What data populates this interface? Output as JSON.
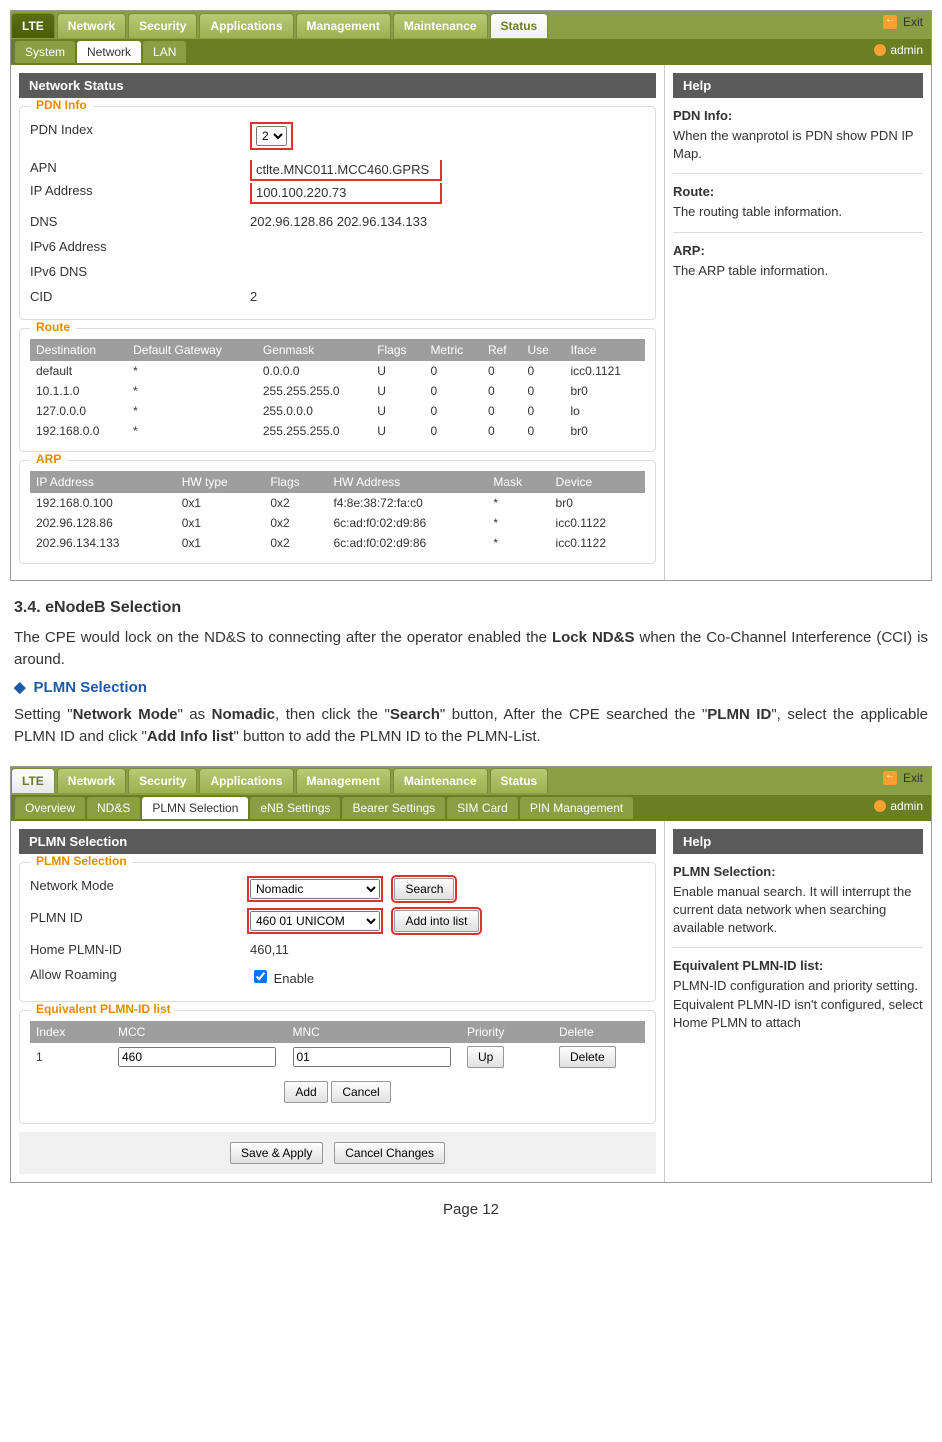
{
  "ui1": {
    "topTabs": [
      "LTE",
      "Network",
      "Security",
      "Applications",
      "Management",
      "Maintenance",
      "Status"
    ],
    "topActive": "Status",
    "exit": "Exit",
    "subTabs": [
      "System",
      "Network",
      "LAN"
    ],
    "subActive": "Network",
    "user": "admin",
    "mainTitle": "Network Status",
    "pdn": {
      "legend": "PDN Info",
      "rows": [
        {
          "label": "PDN Index",
          "value": "2",
          "select": true
        },
        {
          "label": "APN",
          "value": "ctlte.MNC011.MCC460.GPRS"
        },
        {
          "label": "IP Address",
          "value": "100.100.220.73"
        },
        {
          "label": "DNS",
          "value": "202.96.128.86    202.96.134.133"
        },
        {
          "label": "IPv6 Address",
          "value": ""
        },
        {
          "label": "IPv6 DNS",
          "value": ""
        },
        {
          "label": "CID",
          "value": "2"
        }
      ]
    },
    "route": {
      "legend": "Route",
      "headers": [
        "Destination",
        "Default Gateway",
        "Genmask",
        "Flags",
        "Metric",
        "Ref",
        "Use",
        "Iface"
      ],
      "rows": [
        [
          "default",
          "*",
          "0.0.0.0",
          "U",
          "0",
          "0",
          "0",
          "icc0.1121"
        ],
        [
          "10.1.1.0",
          "*",
          "255.255.255.0",
          "U",
          "0",
          "0",
          "0",
          "br0"
        ],
        [
          "127.0.0.0",
          "*",
          "255.0.0.0",
          "U",
          "0",
          "0",
          "0",
          "lo"
        ],
        [
          "192.168.0.0",
          "*",
          "255.255.255.0",
          "U",
          "0",
          "0",
          "0",
          "br0"
        ]
      ]
    },
    "arp": {
      "legend": "ARP",
      "headers": [
        "IP Address",
        "HW type",
        "Flags",
        "HW Address",
        "Mask",
        "Device"
      ],
      "rows": [
        [
          "192.168.0.100",
          "0x1",
          "0x2",
          "f4:8e:38:72:fa:c0",
          "*",
          "br0"
        ],
        [
          "202.96.128.86",
          "0x1",
          "0x2",
          "6c:ad:f0:02:d9:86",
          "*",
          "icc0.1122"
        ],
        [
          "202.96.134.133",
          "0x1",
          "0x2",
          "6c:ad:f0:02:d9:86",
          "*",
          "icc0.1122"
        ]
      ]
    },
    "help": {
      "title": "Help",
      "sections": [
        {
          "h": "PDN Info:",
          "t": "When the wanprotol is PDN show PDN IP Map."
        },
        {
          "h": "Route:",
          "t": "The routing table information."
        },
        {
          "h": "ARP:",
          "t": "The ARP table information."
        }
      ]
    }
  },
  "doc": {
    "h": "3.4.   eNodeB Selection",
    "p1a": "The CPE would lock on the ND&S to connecting after the operator enabled the ",
    "p1b": "Lock ND&S",
    "p1c": " when the Co-Channel Interference (CCI) is around.",
    "sub": "PLMN Selection",
    "p2a": "Setting \"",
    "p2b": "Network Mode",
    "p2c": "\" as ",
    "p2d": "Nomadic",
    "p2e": ", then click the \"",
    "p2f": "Search",
    "p2g": "\" button, After the CPE searched the \"",
    "p2h": "PLMN ID",
    "p2i": "\", select the applicable PLMN ID and click \"",
    "p2j": "Add Info list",
    "p2k": "\" button to add the PLMN ID to the PLMN-List."
  },
  "ui2": {
    "topTabs": [
      "LTE",
      "Network",
      "Security",
      "Applications",
      "Management",
      "Maintenance",
      "Status"
    ],
    "topActive": "LTE",
    "exit": "Exit",
    "subTabs": [
      "Overview",
      "ND&S",
      "PLMN Selection",
      "eNB Settings",
      "Bearer Settings",
      "SIM Card",
      "PIN Management"
    ],
    "subActive": "PLMN Selection",
    "user": "admin",
    "mainTitle": "PLMN Selection",
    "sel": {
      "legend": "PLMN Selection",
      "networkModeLabel": "Network Mode",
      "networkMode": "Nomadic",
      "searchBtn": "Search",
      "plmnIdLabel": "PLMN ID",
      "plmnId": "460 01 UNICOM",
      "addBtn": "Add into list",
      "homeLabel": "Home PLMN-ID",
      "home": "460,11",
      "roamLabel": "Allow Roaming",
      "roam": "Enable"
    },
    "eq": {
      "legend": "Equivalent PLMN-ID list",
      "headers": [
        "Index",
        "MCC",
        "MNC",
        "Priority",
        "Delete"
      ],
      "row": {
        "index": "1",
        "mcc": "460",
        "mnc": "01",
        "up": "Up",
        "del": "Delete"
      },
      "add": "Add",
      "cancel": "Cancel"
    },
    "save": "Save & Apply",
    "cancelChanges": "Cancel Changes",
    "help": {
      "title": "Help",
      "sections": [
        {
          "h": "PLMN Selection:",
          "t": "Enable manual search. It will interrupt the current data network when searching available network."
        },
        {
          "h": "Equivalent PLMN-ID list:",
          "t": "PLMN-ID configuration and priority setting. Equivalent PLMN-ID isn't configured, select Home PLMN to attach"
        }
      ]
    }
  },
  "pageNum": "Page 12"
}
